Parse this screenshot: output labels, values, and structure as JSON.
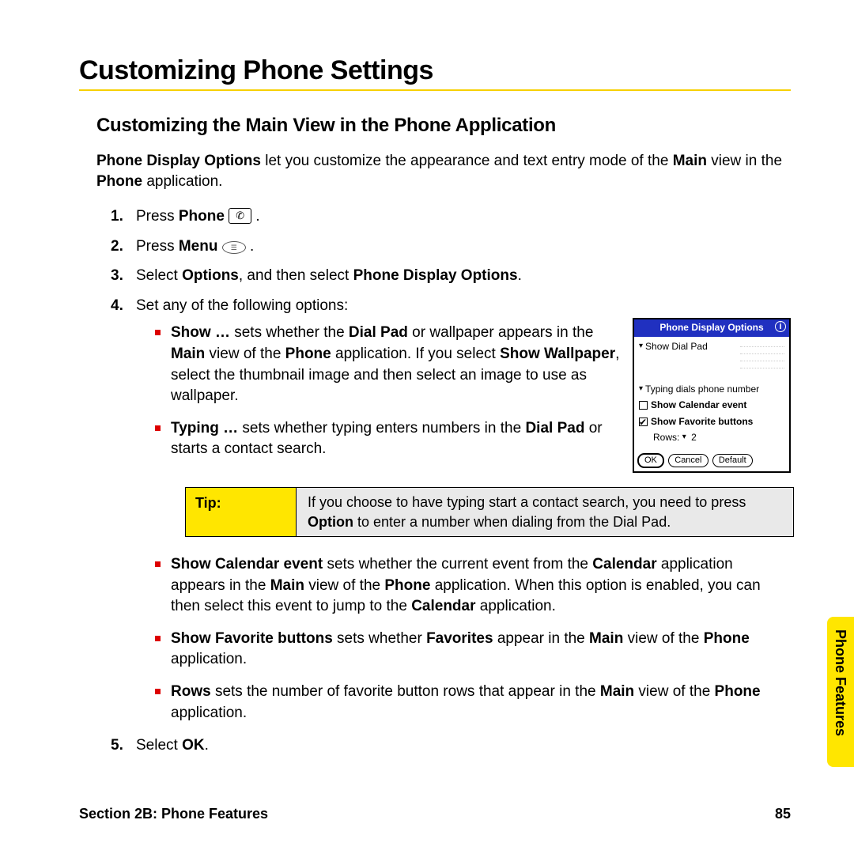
{
  "heading": "Customizing Phone Settings",
  "subheading": "Customizing the Main View in the Phone Application",
  "intro_html": "<b>Phone Display Options</b> let you customize the appearance and text entry mode of the <b>Main</b> view in the <b>Phone</b> application.",
  "steps": {
    "s1": {
      "prefix": "Press ",
      "bold": "Phone",
      "suffix": " "
    },
    "s2": {
      "prefix": "Press ",
      "bold": "Menu",
      "suffix": " "
    },
    "s3_html": "Select <b>Options</b>, and then select <b>Phone Display Options</b>.",
    "s4": "Set any of the following options:",
    "s5_html": "Select <b>OK</b>."
  },
  "bullets_top": {
    "b1_html": "<b>Show …</b> sets whether the <b>Dial Pad</b> or wallpaper appears in the <b>Main</b> view of the <b>Phone</b> application. If you select <b>Show Wallpaper</b>, select the thumbnail image and then select an image to use as wallpaper.",
    "b2_html": "<b>Typing …</b> sets whether typing enters numbers in the <b>Dial Pad</b> or starts a contact search."
  },
  "tip": {
    "label": "Tip:",
    "body_html": "If you choose to have typing start a contact search, you need to press <b>Option</b> to enter a number when dialing from the Dial Pad."
  },
  "bullets_bottom": {
    "b3_html": "<b>Show Calendar event</b> sets whether the current event from the <b>Calendar</b> application appears in the <b>Main</b> view of the <b>Phone</b> application. When this option is enabled, you can then select this event to jump to the <b>Calendar</b> application.",
    "b4_html": "<b>Show Favorite buttons</b> sets whether <b>Favorites</b> appear in the <b>Main</b> view of the <b>Phone</b> application.",
    "b5_html": "<b>Rows</b> sets the number of favorite button rows that appear in the <b>Main</b> view of the <b>Phone</b> application."
  },
  "mock": {
    "title": "Phone Display Options",
    "show_dial": "Show Dial Pad",
    "typing": "Typing dials phone number",
    "calendar": "Show Calendar event",
    "favorites": "Show Favorite buttons",
    "rows_label": "Rows:",
    "rows_value": "2",
    "ok": "OK",
    "cancel": "Cancel",
    "default": "Default"
  },
  "sidetab": "Phone Features",
  "footer_left": "Section 2B: Phone Features",
  "footer_right": "85"
}
